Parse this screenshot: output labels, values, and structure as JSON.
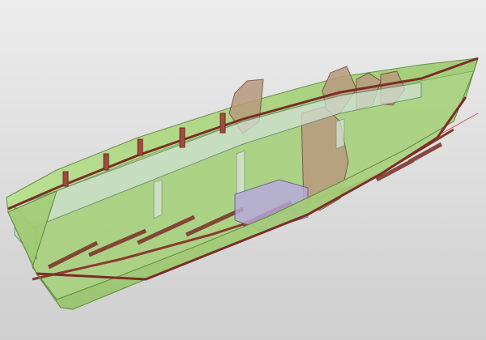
{
  "scene": {
    "subject": "boat-hull",
    "colors": {
      "background": "#d7d7d7",
      "hull_green": "#a8d47a",
      "hull_green_dark": "#8fbf62",
      "frame_red": "#8a3a30",
      "bulkhead": "#b99a7e",
      "glass": "#c9dccd",
      "axis_red": "#d05050"
    }
  }
}
